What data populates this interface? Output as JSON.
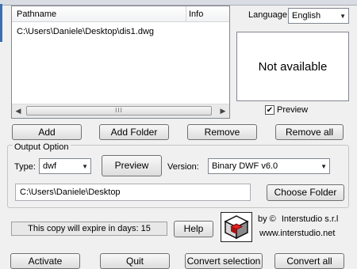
{
  "filelist": {
    "col_pathname": "Pathname",
    "col_info": "Info",
    "rows": [
      {
        "path": "C:\\Users\\Daniele\\Desktop\\dis1.dwg"
      }
    ],
    "scroll_thumb": "III"
  },
  "language": {
    "label": "Language:",
    "value": "English"
  },
  "preview": {
    "status": "Not available",
    "checkbox_label": "Preview",
    "checked": true
  },
  "buttons": {
    "add": "Add",
    "add_folder": "Add Folder",
    "remove": "Remove",
    "remove_all": "Remove all",
    "preview": "Preview",
    "choose_folder": "Choose Folder",
    "help": "Help",
    "activate": "Activate",
    "quit": "Quit",
    "convert_selection": "Convert selection",
    "convert_all": "Convert all"
  },
  "output": {
    "title": "Output Option",
    "type_label": "Type:",
    "type_value": "dwf",
    "version_label": "Version:",
    "version_value": "Binary DWF v6.0",
    "folder": "C:\\Users\\Daniele\\Desktop"
  },
  "footer": {
    "expire_text": "This copy will expire in days: 15",
    "by": "by ©",
    "company": "Interstudio s.r.l",
    "website": "www.interstudio.net"
  },
  "icons": {
    "check": "checkmark-icon",
    "dropdown": "chevron-down-icon"
  }
}
